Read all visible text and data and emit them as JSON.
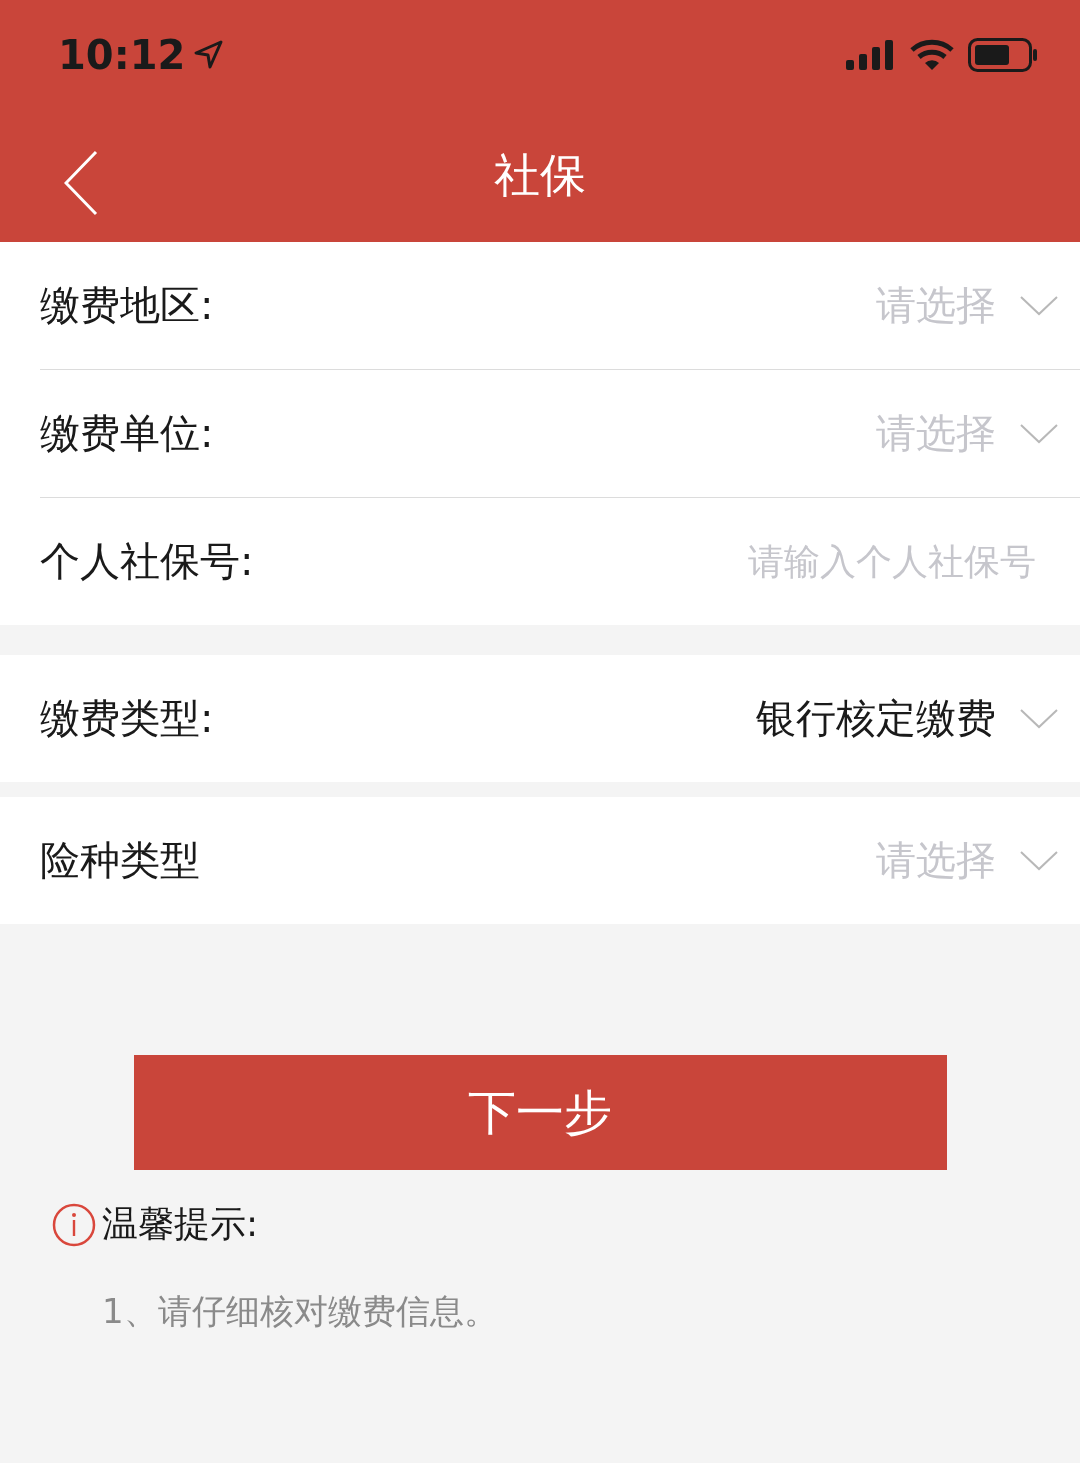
{
  "status_bar": {
    "time": "10:12"
  },
  "nav": {
    "title": "社保"
  },
  "groups": [
    {
      "rows": [
        {
          "kind": "select",
          "label": "缴费地区:",
          "placeholder": "请选择"
        },
        {
          "kind": "select",
          "label": "缴费单位:",
          "placeholder": "请选择"
        },
        {
          "kind": "input",
          "label": "个人社保号:",
          "placeholder": "请输入个人社保号"
        }
      ]
    },
    {
      "rows": [
        {
          "kind": "select",
          "label": "缴费类型:",
          "value": "银行核定缴费"
        }
      ]
    },
    {
      "rows": [
        {
          "kind": "select",
          "label": "险种类型",
          "placeholder": "请选择"
        }
      ]
    }
  ],
  "button": "下一步",
  "tip": {
    "title": "温馨提示:",
    "items": [
      "1、请仔细核对缴费信息。"
    ]
  }
}
